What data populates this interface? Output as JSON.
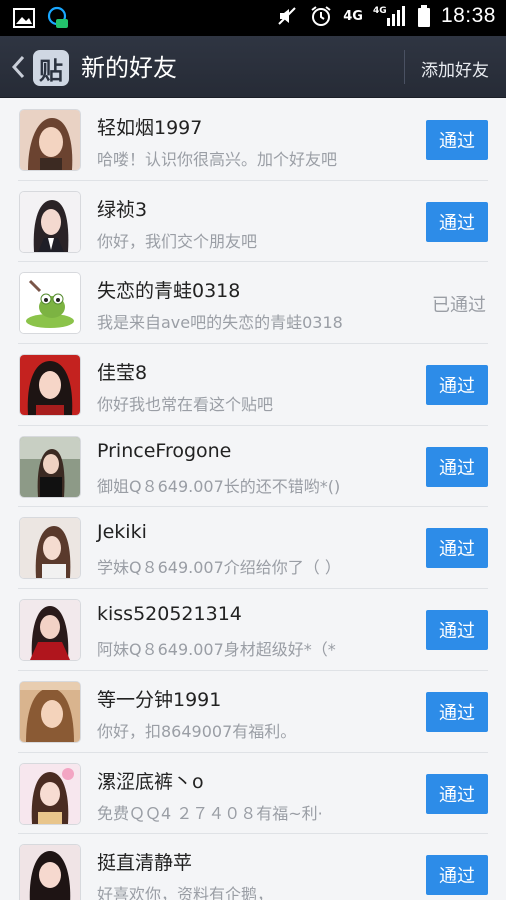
{
  "status_bar": {
    "time": "18:38",
    "network_labels": [
      "4G",
      "4G"
    ],
    "icons": [
      "image-icon",
      "chat-bubble-icon",
      "mute-icon",
      "alarm-icon",
      "signal-icon",
      "battery-icon"
    ]
  },
  "header": {
    "app_logo_char": "贴",
    "title": "新的好友",
    "add_friend_label": "添加好友"
  },
  "colors": {
    "accent": "#2d8ce8",
    "titlebar": "#2f3542",
    "muted_text": "#9a9ea5"
  },
  "friends": [
    {
      "name": "轻如烟1997",
      "message": "哈喽！认识你很高兴。加个好友吧",
      "action": "通过",
      "status": "pending"
    },
    {
      "name": "绿祯3",
      "message": "你好，我们交个朋友吧",
      "action": "通过",
      "status": "pending"
    },
    {
      "name": "失恋的青蛙0318",
      "message": "我是来自ave吧的失恋的青蛙0318",
      "action": "已通过",
      "status": "accepted"
    },
    {
      "name": "佳莹8",
      "message": "你好我也常在看这个贴吧",
      "action": "通过",
      "status": "pending"
    },
    {
      "name": "PrinceFrogone",
      "message": "御姐Q８649.007长的还不错哟*()",
      "action": "通过",
      "status": "pending"
    },
    {
      "name": "Jekiki",
      "message": "学妹Q８649.007介绍给你了（ ）",
      "action": "通过",
      "status": "pending"
    },
    {
      "name": "kiss520521314",
      "message": "阿妹Q８649.007身材超级好*（*",
      "action": "通过",
      "status": "pending"
    },
    {
      "name": "等一分钟1991",
      "message": "你好，扣8649007有福利。",
      "action": "通过",
      "status": "pending"
    },
    {
      "name": "漯涩底裤丶o",
      "message": "免费ＱＱ4 ２７４０８有福~利·",
      "action": "通过",
      "status": "pending"
    },
    {
      "name": "挺直清静苹",
      "message": "好喜欢你，资料有企鹅，",
      "action": "通过",
      "status": "pending"
    }
  ]
}
